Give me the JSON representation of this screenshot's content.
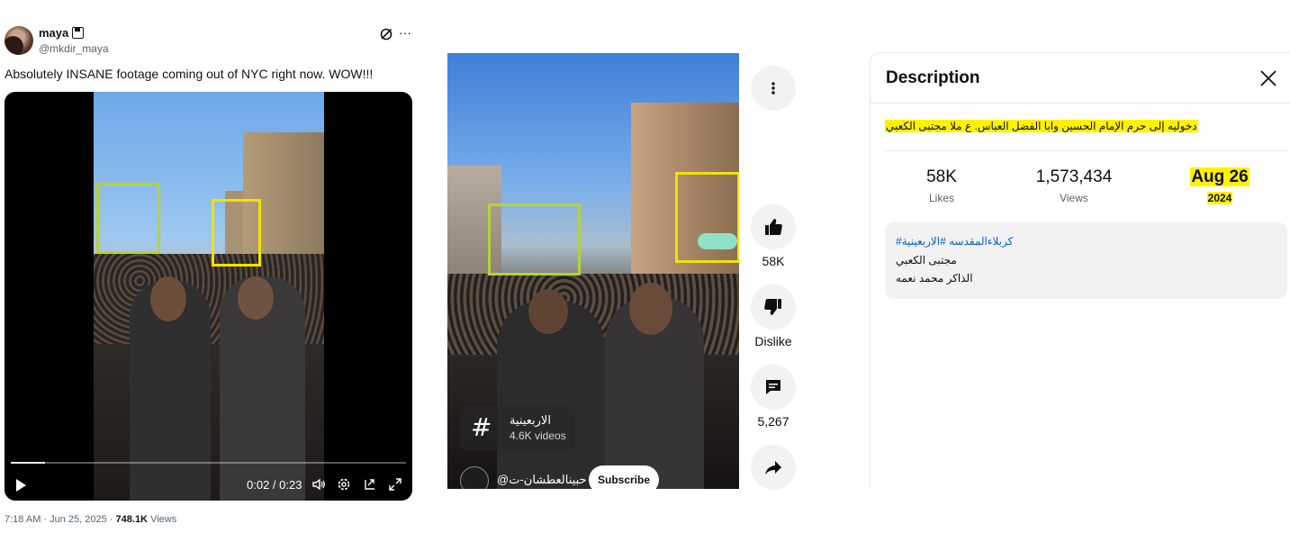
{
  "tweet": {
    "display_name": "maya",
    "handle": "@mkdir_maya",
    "text": "Absolutely INSANE footage coming out of NYC right now. WOW!!!",
    "video": {
      "time": "0:02 / 0:23",
      "progress": 0.087
    },
    "meta": {
      "timestamp": "7:18 AM · Jun 25, 2025 · ",
      "views_count": "748.1K",
      "views_label": " Views"
    },
    "icons": [
      "grok-icon",
      "more-icon",
      "play-icon",
      "volume-icon",
      "settings-icon",
      "pip-icon",
      "fullscreen-icon"
    ]
  },
  "short": {
    "hashtag_title": "الاربعينية",
    "hashtag_count": "4.6K videos",
    "channel_name": "@حبينالعطشان-ت",
    "subscribe_label": "Subscribe"
  },
  "rail": {
    "likes": "58K",
    "dislike_label": "Dislike",
    "comments": "5,267"
  },
  "description": {
    "title": "Description",
    "text": "دخوليه إلى حرم الإمام الحسين وابا الفضل العباس. ع ملا مجتبى الكعبي",
    "stats": {
      "likes_value": "58K",
      "likes_label": "Likes",
      "views_value": "1,573,434",
      "views_label": "Views",
      "date_value": "Aug 26",
      "date_year": "2024"
    },
    "tags_link": "#كربلاءالمقدسه #الاربعينية",
    "line1": "مجتبى الكعبي",
    "line2": "الذاكر محمد نعمه"
  },
  "colors": {
    "highlight_yellow": "#fff200",
    "box_lime": "#b5d334",
    "box_yellow": "#f2e200",
    "link_blue": "#065fd4"
  }
}
